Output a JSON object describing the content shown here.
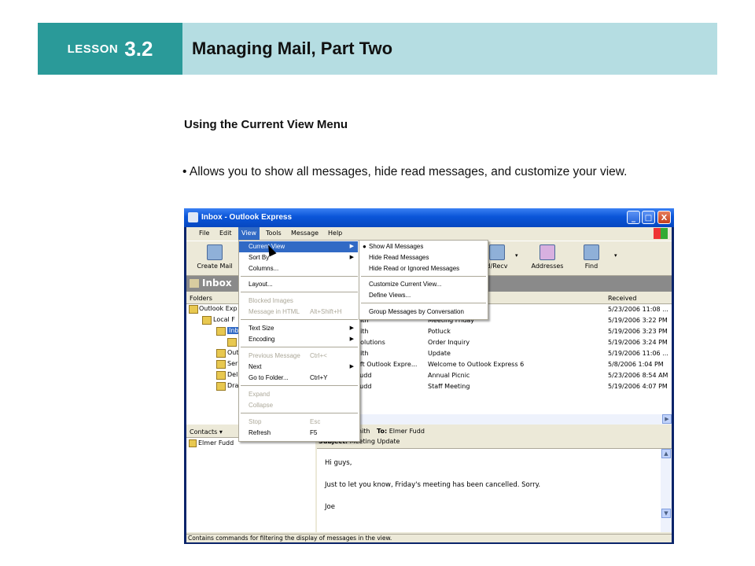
{
  "slide": {
    "lesson_word": "LESSON",
    "lesson_number": "3.2",
    "title": "Managing Mail, Part Two",
    "subheading": "Using the Current View Menu",
    "bullet": "• Allows you to show all messages, hide read messages, and customize your view."
  },
  "window": {
    "title": "Inbox - Outlook Express",
    "controls": [
      "_",
      "□",
      "X"
    ],
    "menubar": [
      "File",
      "Edit",
      "View",
      "Tools",
      "Message",
      "Help"
    ],
    "toolbar": {
      "create_mail": "Create Mail",
      "send_recv": "d/Recv",
      "addresses": "Addresses",
      "find": "Find"
    },
    "folder_bar_label": "Inbox",
    "folders": {
      "header": "Folders",
      "items": [
        "Outlook Exp",
        "Local F",
        "Inb",
        "Out",
        "Ser",
        "Del",
        "Dra"
      ]
    },
    "contacts": {
      "header": "Contacts ▾",
      "items": [
        "Elmer Fudd"
      ]
    },
    "messages": {
      "received_header": "Received",
      "rows": [
        {
          "from": "",
          "subject": "",
          "received": "5/23/2006 11:08 ..."
        },
        {
          "from": "nith",
          "subject": "Meeting Friday",
          "received": "5/19/2006 3:22 PM"
        },
        {
          "from": "nith",
          "subject": "Potluck",
          "received": "5/19/2006 3:23 PM"
        },
        {
          "from": "Solutions",
          "subject": "Order Inquiry",
          "received": "5/19/2006 3:24 PM"
        },
        {
          "from": "nith",
          "subject": "Update",
          "received": "5/19/2006 11:06 ..."
        },
        {
          "from": "oft Outlook Expre...",
          "subject": "Welcome to Outlook Express 6",
          "received": "5/8/2006 1:04 PM"
        },
        {
          "from": "Fudd",
          "subject": "Annual Picnic",
          "received": "5/23/2006 8:54 AM"
        },
        {
          "from": "Fudd",
          "subject": "Staff Meeting",
          "received": "5/19/2006 4:07 PM"
        }
      ]
    },
    "preview": {
      "from_line": "nith",
      "to_label": "To:",
      "to_value": "Elmer Fudd",
      "subject_label": "Subject:",
      "subject_value": "Meeting Update",
      "body": [
        "Hi guys,",
        "Just to let you know, Friday's meeting has been cancelled. Sorry.",
        "Joe"
      ]
    },
    "status": "Contains commands for filtering the display of messages in the view.",
    "view_menu": [
      {
        "label": "Current View",
        "submenu": true,
        "highlighted": true
      },
      {
        "label": "Sort By",
        "submenu": true
      },
      {
        "label": "Columns..."
      },
      {
        "label": "Layout..."
      },
      {
        "label": "Blocked Images",
        "disabled": true
      },
      {
        "label": "Message in HTML",
        "shortcut": "Alt+Shift+H",
        "disabled": true
      },
      {
        "label": "Text Size",
        "submenu": true
      },
      {
        "label": "Encoding",
        "submenu": true
      },
      {
        "label": "Previous Message",
        "shortcut": "Ctrl+<",
        "disabled": true
      },
      {
        "label": "Next",
        "submenu": true
      },
      {
        "label": "Go to Folder...",
        "shortcut": "Ctrl+Y"
      },
      {
        "label": "Expand",
        "disabled": true
      },
      {
        "label": "Collapse",
        "disabled": true
      },
      {
        "label": "Stop",
        "shortcut": "Esc",
        "disabled": true
      },
      {
        "label": "Refresh",
        "shortcut": "F5"
      }
    ],
    "current_view_menu": [
      {
        "label": "Show All Messages",
        "checked": true
      },
      {
        "label": "Hide Read Messages"
      },
      {
        "label": "Hide Read or Ignored Messages"
      },
      {
        "label": "Customize Current View..."
      },
      {
        "label": "Define Views..."
      },
      {
        "label": "Group Messages by Conversation"
      }
    ]
  }
}
